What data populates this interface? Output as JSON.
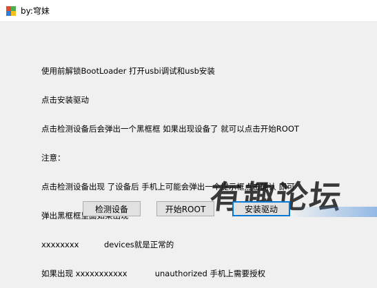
{
  "window": {
    "title": "by:穹妹"
  },
  "instructions": [
    "使用前解锁BootLoader 打开usbi调试和usb安装",
    "点击安装驱动",
    "点击检测设备后会弹出一个黑框框 如果出现设备了 就可以点击开始ROOT",
    "注意：",
    "点击检测设备出现 了设备后 手机上可能会弹出一个提示框点击确认 即可",
    "弹出黑框框里面如果出现",
    "xxxxxxxx          devices就是正常的",
    "如果出现 xxxxxxxxxxx           unauthorized 手机上需要授权"
  ],
  "buttons": {
    "detect_label": "检测设备",
    "root_label": "开始ROOT",
    "install_label": "安装驱动"
  },
  "watermark": {
    "text": "有趣论坛"
  },
  "colors": {
    "window_bg": "#f0f0f0",
    "button_bg": "#e1e1e1",
    "focus_border": "#0078d7"
  }
}
